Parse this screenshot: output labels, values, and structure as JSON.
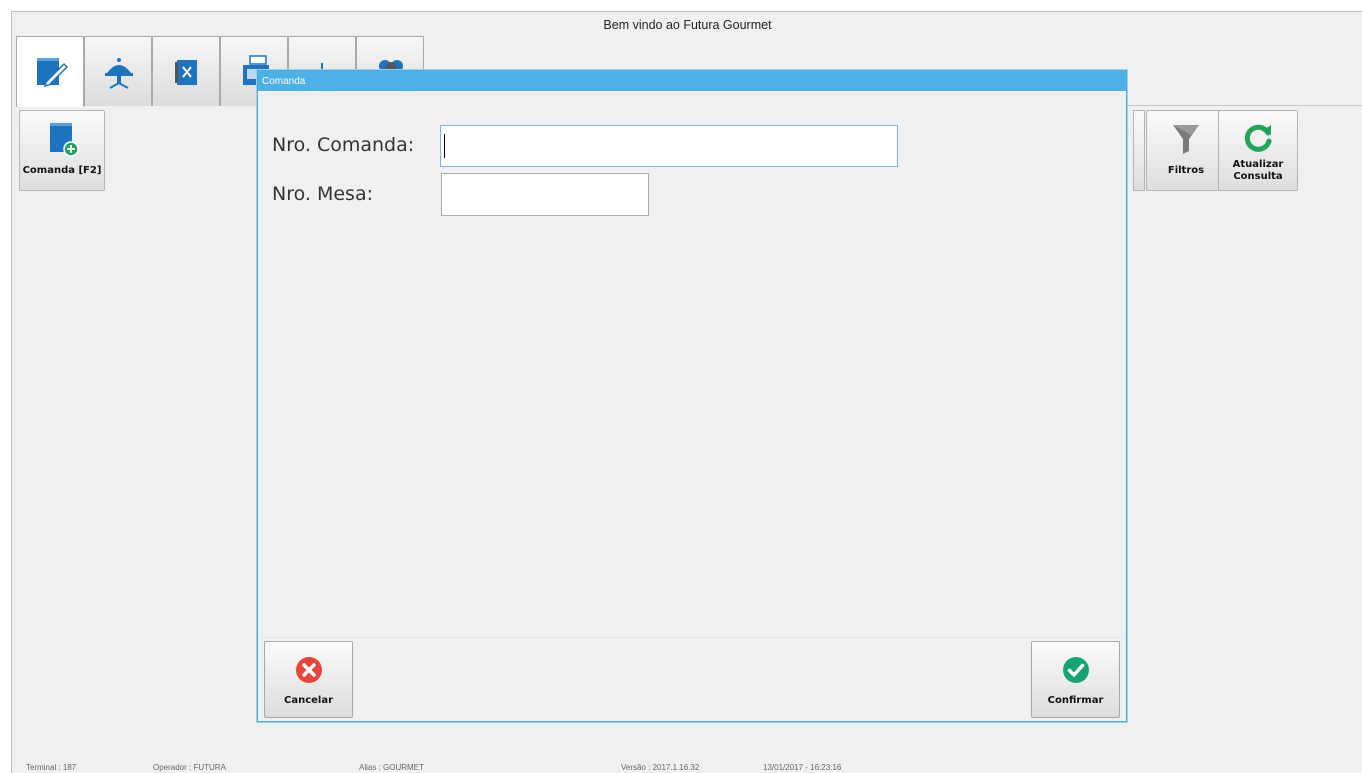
{
  "app": {
    "title": "Bem vindo ao Futura Gourmet"
  },
  "tabs": [
    {
      "icon": "notepad-pencil-icon"
    },
    {
      "icon": "served-dish-icon"
    },
    {
      "icon": "menu-book-icon"
    },
    {
      "icon": "cash-register-icon"
    },
    {
      "icon": "scale-icon"
    },
    {
      "icon": "people-icon"
    }
  ],
  "toolbar": {
    "comanda_label": "Comanda [F2]",
    "filtros_label": "Filtros",
    "atualizar_label": "Atualizar Consulta"
  },
  "dialog": {
    "title": "Comanda",
    "nro_comanda_label": "Nro. Comanda:",
    "nro_comanda_value": "",
    "nro_mesa_label": "Nro. Mesa:",
    "nro_mesa_value": "",
    "cancel_label": "Cancelar",
    "confirm_label": "Confirmar"
  },
  "status_bar": {
    "terminal": "Terminal : 187",
    "operador": "Operador : FUTURA",
    "alias": "Alias : GOURMET",
    "versao": "Versão : 2017.1.16.32",
    "datetime": "13/01/2017 - 16:23:16"
  },
  "colors": {
    "dialog_title_bg": "#4cb1e6",
    "cancel_red": "#e8453c",
    "confirm_green": "#17a372",
    "icon_blue": "#1e73be",
    "icon_green": "#22a35a"
  }
}
